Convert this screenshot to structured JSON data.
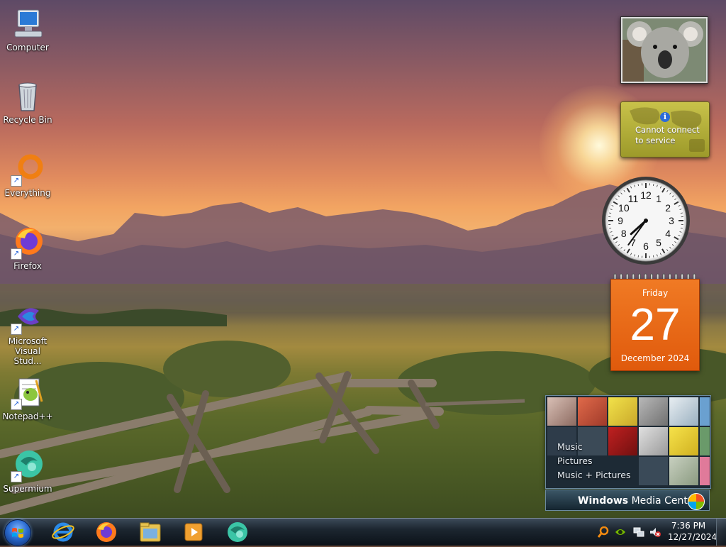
{
  "desktop": {
    "icons": [
      {
        "label": "Computer",
        "icon": "computer-icon"
      },
      {
        "label": "Recycle Bin",
        "icon": "recycle-bin-icon"
      },
      {
        "label": "Everything",
        "icon": "everything-icon"
      },
      {
        "label": "Firefox",
        "icon": "firefox-icon"
      },
      {
        "label": "Microsoft Visual Stud...",
        "icon": "visual-studio-icon"
      },
      {
        "label": "Notepad++",
        "icon": "notepad-plus-plus-icon"
      },
      {
        "label": "Supermium",
        "icon": "supermium-icon"
      }
    ]
  },
  "gadgets": {
    "weather": {
      "message": "Cannot connect to service",
      "line1": "Cannot connect",
      "line2": "to service"
    },
    "clock": {
      "hour": 7,
      "minute": 36,
      "numbers": [
        "12",
        "1",
        "2",
        "3",
        "4",
        "5",
        "6",
        "7",
        "8",
        "9",
        "10",
        "11"
      ]
    },
    "calendar": {
      "weekday": "Friday",
      "day": "27",
      "month_year": "December 2024",
      "color": "#e8661a"
    },
    "media_center": {
      "links": [
        "Music",
        "Pictures",
        "Music + Pictures"
      ],
      "bar_text_bold": "Windows",
      "bar_text": " Media Center"
    }
  },
  "taskbar": {
    "start_icon": "windows-start-orb",
    "pinned": [
      "internet-explorer-icon",
      "firefox-icon",
      "file-explorer-icon",
      "media-player-icon",
      "supermium-icon"
    ],
    "tray_icons": [
      "search-icon",
      "nvidia-icon",
      "network-icon",
      "volume-muted-icon"
    ],
    "time": "7:36 PM",
    "date": "12/27/2024"
  }
}
